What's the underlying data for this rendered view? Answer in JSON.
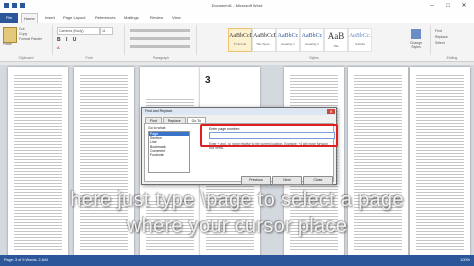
{
  "window": {
    "title": "Document1 - Microsoft Word"
  },
  "tabs": [
    "File",
    "Home",
    "Insert",
    "Page Layout",
    "References",
    "Mailings",
    "Review",
    "View"
  ],
  "active_tab": "Home",
  "ribbon": {
    "clipboard": {
      "label": "Clipboard",
      "paste": "Paste",
      "cut": "Cut",
      "copy": "Copy",
      "format_painter": "Format Painter"
    },
    "font": {
      "label": "Font",
      "name": "Cambria (Body)",
      "size": "11",
      "buttons": "B I U"
    },
    "paragraph": {
      "label": "Paragraph"
    },
    "styles": {
      "label": "Styles",
      "items": [
        {
          "sample": "AaBbCcDc",
          "name": "¶ Normal"
        },
        {
          "sample": "AaBbCcDc",
          "name": "Title Spac..."
        },
        {
          "sample": "AaBbCc",
          "name": "Heading 1"
        },
        {
          "sample": "AaBbCc",
          "name": "Heading 2"
        },
        {
          "sample": "AaB",
          "name": "Title"
        },
        {
          "sample": "AaBbCc.",
          "name": "Subtitle"
        }
      ],
      "change_styles": "Change Styles"
    },
    "editing": {
      "label": "Editing",
      "find": "Find",
      "replace": "Replace",
      "select": "Select"
    }
  },
  "page3_number": "3",
  "dialog": {
    "title": "Find and Replace",
    "close": "✕",
    "tabs": [
      "Find",
      "Replace",
      "Go To"
    ],
    "active_tab": "Go To",
    "goto_what_label": "Go to what:",
    "goto_items": [
      "Page",
      "Section",
      "Line",
      "Bookmark",
      "Comment",
      "Footnote"
    ],
    "selected_item": "Page",
    "enter_label": "Enter page number:",
    "page_input_value": "",
    "hint": "Enter + and - to move relative to the current location. Example: +4 will move forward four items.",
    "buttons": [
      "Previous",
      "Next",
      "Close"
    ]
  },
  "overlay": {
    "line1": "here just type \\page to select a page",
    "line2": "where your cursor place"
  },
  "status": {
    "left": "Page: 3 of 9    Words: 2,844",
    "right": "100%"
  }
}
